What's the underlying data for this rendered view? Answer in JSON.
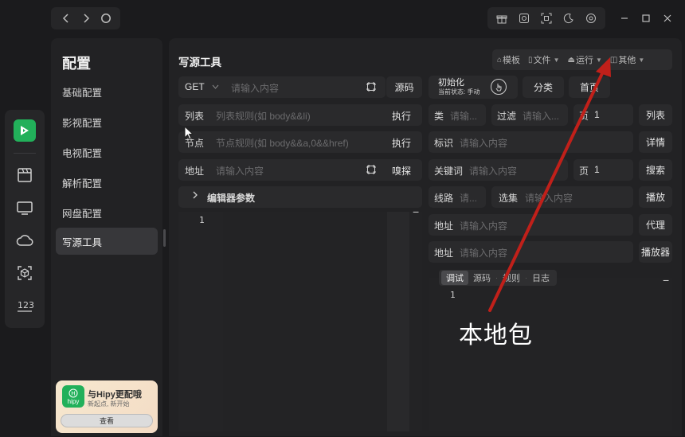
{
  "titlebar": {
    "nav": [
      "back-icon",
      "forward-icon",
      "refresh-icon"
    ],
    "tools": [
      "gift-icon",
      "camera-icon",
      "scan-icon",
      "moon-icon",
      "settings-icon"
    ],
    "window": [
      "minimize-icon",
      "maximize-icon",
      "close-icon"
    ]
  },
  "rail": {
    "items": [
      "film-icon",
      "tv-icon",
      "cloud-icon",
      "cube-scan-icon",
      "numbers-icon"
    ]
  },
  "sidebar": {
    "title": "配置",
    "items": [
      {
        "label": "基础配置"
      },
      {
        "label": "影视配置"
      },
      {
        "label": "电视配置"
      },
      {
        "label": "解析配置"
      },
      {
        "label": "网盘配置"
      },
      {
        "label": "写源工具"
      }
    ],
    "promo": {
      "logo_text": "hipy",
      "title": "与Hipy更配哦",
      "subtitle": "新起点, 新开始",
      "button": "查看"
    }
  },
  "main": {
    "title": "写源工具",
    "menu": [
      {
        "label": "模板"
      },
      {
        "label": "文件"
      },
      {
        "label": "运行"
      },
      {
        "label": "其他"
      }
    ],
    "url_row": {
      "method": "GET",
      "placeholder": "请输入内容",
      "source_btn": "源码"
    },
    "init": {
      "label": "初始化",
      "status": "当前状态: 手动"
    },
    "category_btn": "分类",
    "home_btn": "首页",
    "list_row": {
      "label": "列表",
      "placeholder": "列表规则(如 body&&li)",
      "btn": "执行"
    },
    "node_row": {
      "label": "节点",
      "placeholder": "节点规则(如 body&&a,0&&href)",
      "btn": "执行"
    },
    "addr_row": {
      "label": "地址",
      "placeholder": "请输入内容",
      "btn": "嗅探"
    },
    "editor_params": "编辑器参数",
    "editor_line": "1",
    "right": {
      "class_label": "类",
      "class_ph": "请输...",
      "filter_label": "过滤",
      "filter_ph": "请输入...",
      "page_label": "页",
      "page_val": "1",
      "list_btn": "列表",
      "id_label": "标识",
      "id_ph": "请输入内容",
      "detail_btn": "详情",
      "kw_label": "关键词",
      "kw_ph": "请输入内容",
      "page2_label": "页",
      "page2_val": "1",
      "search_btn": "搜索",
      "route_label": "线路",
      "route_ph": "请...",
      "episode_label": "选集",
      "episode_ph": "请输入内容",
      "play_btn": "播放",
      "addr1_label": "地址",
      "addr1_ph": "请输入内容",
      "proxy_btn": "代理",
      "addr2_label": "地址",
      "addr2_ph": "请输入内容",
      "player_btn": "播放器"
    },
    "console_tabs": [
      "调试",
      "源码",
      "规则",
      "日志"
    ],
    "console_line": "1"
  },
  "annotation": {
    "text": "本地包",
    "color": "#c0201a"
  }
}
